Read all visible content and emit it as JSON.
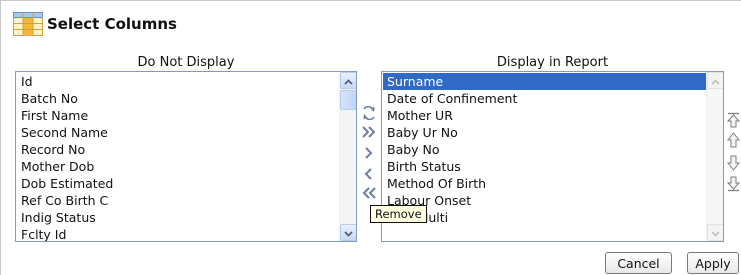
{
  "header": {
    "title": "Select Columns",
    "icon": "table-icon"
  },
  "columns": {
    "left_heading": "Do Not Display",
    "right_heading": "Display in Report"
  },
  "do_not_display": {
    "items": [
      "Id",
      "Batch No",
      "First Name",
      "Second Name",
      "Record No",
      "Mother Dob",
      "Dob Estimated",
      "Ref Co Birth C",
      "Indig Status",
      "Fclty Id"
    ]
  },
  "display_in_report": {
    "selected_index": 0,
    "items": [
      "Surname",
      "Date of Confinement",
      "Mother UR",
      "Baby Ur No",
      "Baby No",
      "Birth Status",
      "Method Of Birth",
      "Labour Onset",
      "Fum Multi"
    ]
  },
  "transfer_buttons": [
    "reset-icon",
    "move-all-icon",
    "move-icon",
    "remove-icon",
    "remove-all-icon"
  ],
  "order_buttons": [
    "move-top-icon",
    "move-up-icon",
    "move-down-icon",
    "move-bottom-icon"
  ],
  "tooltip": {
    "text": "Remove"
  },
  "buttons": {
    "cancel": "Cancel",
    "apply": "Apply"
  },
  "colors": {
    "selection": "#316ac5",
    "list_border": "#7f9db9",
    "tooltip_bg": "#ffffe1",
    "scroll_accent": "#c8d8f6"
  }
}
